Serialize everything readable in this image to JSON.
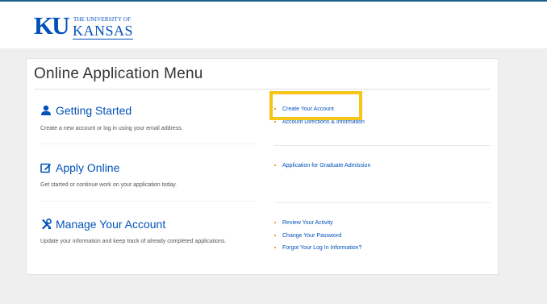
{
  "brand": {
    "logo_letters": "KU",
    "logo_small": "THE UNIVERSITY OF",
    "logo_big": "KANSAS"
  },
  "page": {
    "title": "Online Application Menu"
  },
  "sections": [
    {
      "title": "Getting Started",
      "icon": "user-icon",
      "description": "Create a new account or log in using your email address.",
      "links": [
        "Create Your Account",
        "Account Directions & Information"
      ]
    },
    {
      "title": "Apply Online",
      "icon": "edit-icon",
      "description": "Get started or continue work on your application today.",
      "links": [
        "Application for Graduate Admission"
      ]
    },
    {
      "title": "Manage Your Account",
      "icon": "tools-icon",
      "description": "Update your information and keep track of already completed applications.",
      "links": [
        "Review Your Activity",
        "Change Your Password",
        "Forgot Your Log In Information?"
      ]
    }
  ],
  "colors": {
    "brand_blue": "#0051ba",
    "bullet": "#e8a03c",
    "highlight": "#f5c518"
  }
}
